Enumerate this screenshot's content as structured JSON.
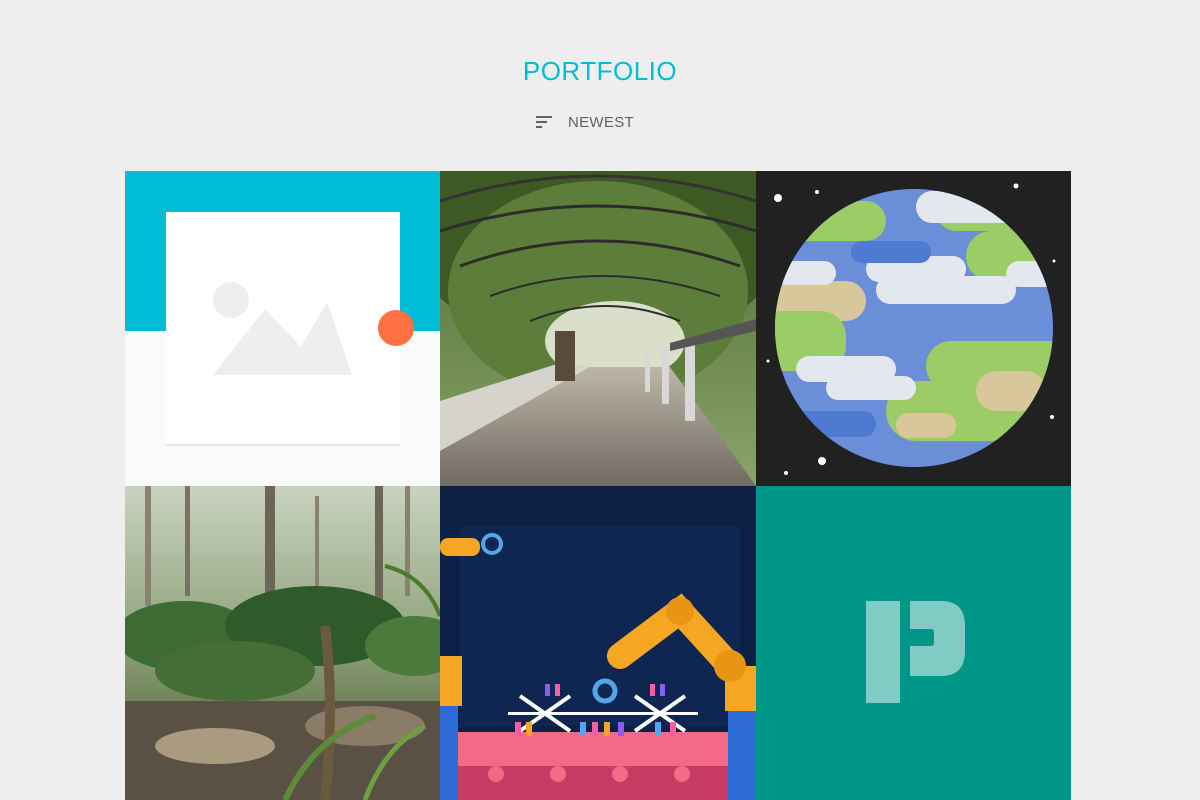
{
  "header": {
    "title": "PORTFOLIO",
    "sort_label": "NEWEST",
    "sort_icon": "sort-icon"
  },
  "colors": {
    "accent": "#00bcd4",
    "background": "#eeeeee",
    "fab": "#ff7043",
    "teal_tile": "#009688",
    "space": "#212121"
  },
  "gallery": {
    "items": [
      {
        "name": "image-placeholder",
        "kind": "placeholder"
      },
      {
        "name": "green-tunnel-pergola",
        "kind": "photo"
      },
      {
        "name": "planet-earth-illustration",
        "kind": "illustration"
      },
      {
        "name": "forest-floor-ivy",
        "kind": "photo"
      },
      {
        "name": "robot-arms-dna-illustration",
        "kind": "illustration"
      },
      {
        "name": "polymer-p-logo",
        "kind": "logo"
      }
    ]
  }
}
